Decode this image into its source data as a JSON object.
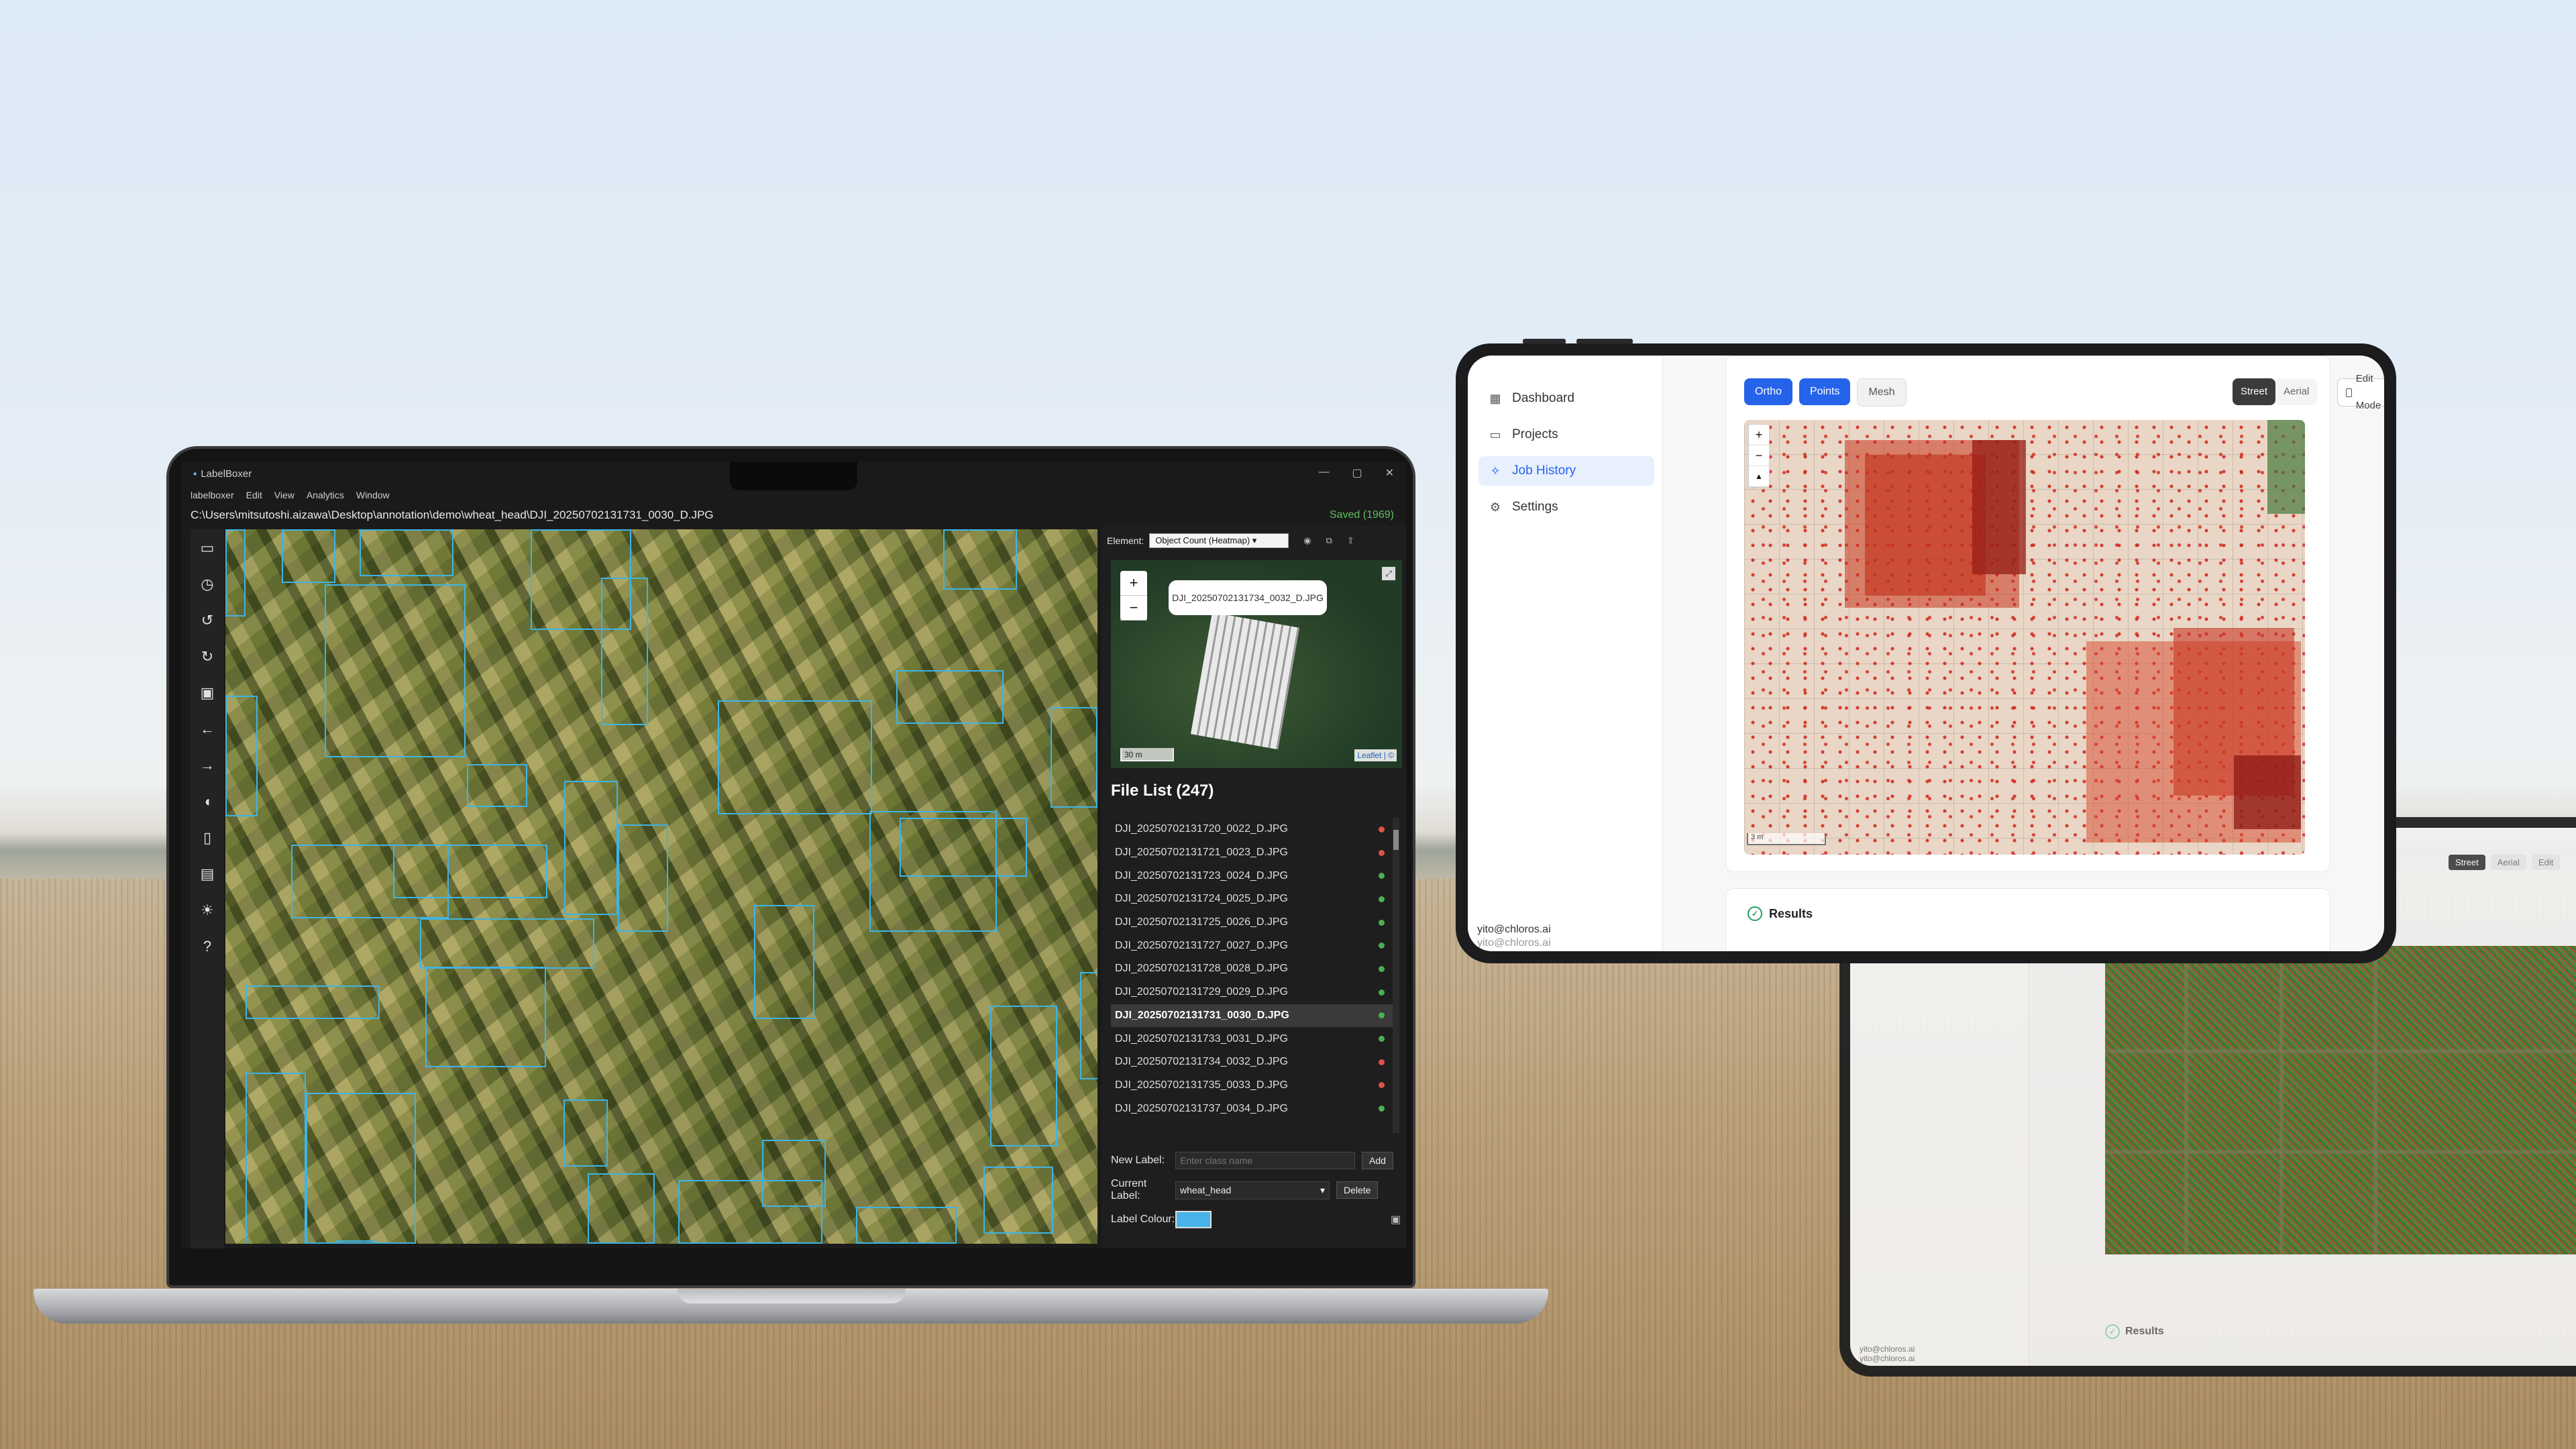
{
  "laptop": {
    "app_title": "LabelBoxer",
    "window_controls": [
      "—",
      "▢",
      "✕"
    ],
    "menu": [
      "labelboxer",
      "Edit",
      "View",
      "Analytics",
      "Window"
    ],
    "path": "C:\\Users\\mitsutoshi.aizawa\\Desktop\\annotation\\demo\\wheat_head\\DJI_20250702131731_0030_D.JPG",
    "saved_status": "Saved (1969)",
    "tools": [
      "folder-icon",
      "history-icon",
      "undo-icon",
      "redo-icon",
      "save-icon",
      "arrow-left-icon",
      "arrow-right-icon",
      "label-icon",
      "map-icon",
      "chart-icon",
      "brightness-icon",
      "help-icon"
    ],
    "element_label": "Element:",
    "element_value": "Object Count (Heatmap)",
    "minimap": {
      "popup": "DJI_20250702131734_0032_D.JPG",
      "scale": "30 m",
      "attribution": "Leaflet | ©",
      "zoom_in": "+",
      "zoom_out": "−"
    },
    "file_list_title": "File List (247)",
    "files": [
      {
        "name": "DJI_20250702131720_0022_D.JPG",
        "status": "#e0514a",
        "selected": false
      },
      {
        "name": "DJI_20250702131721_0023_D.JPG",
        "status": "#e0514a",
        "selected": false
      },
      {
        "name": "DJI_20250702131723_0024_D.JPG",
        "status": "#4caf50",
        "selected": false
      },
      {
        "name": "DJI_20250702131724_0025_D.JPG",
        "status": "#4caf50",
        "selected": false
      },
      {
        "name": "DJI_20250702131725_0026_D.JPG",
        "status": "#4caf50",
        "selected": false
      },
      {
        "name": "DJI_20250702131727_0027_D.JPG",
        "status": "#4caf50",
        "selected": false
      },
      {
        "name": "DJI_20250702131728_0028_D.JPG",
        "status": "#4caf50",
        "selected": false
      },
      {
        "name": "DJI_20250702131729_0029_D.JPG",
        "status": "#4caf50",
        "selected": false
      },
      {
        "name": "DJI_20250702131731_0030_D.JPG",
        "status": "#4caf50",
        "selected": true
      },
      {
        "name": "DJI_20250702131733_0031_D.JPG",
        "status": "#4caf50",
        "selected": false
      },
      {
        "name": "DJI_20250702131734_0032_D.JPG",
        "status": "#e0514a",
        "selected": false
      },
      {
        "name": "DJI_20250702131735_0033_D.JPG",
        "status": "#e0514a",
        "selected": false
      },
      {
        "name": "DJI_20250702131737_0034_D.JPG",
        "status": "#4caf50",
        "selected": false
      }
    ],
    "new_label": "New Label:",
    "new_label_placeholder": "Enter class name",
    "add_button": "Add",
    "current_label": "Current Label:",
    "current_label_value": "wheat_head",
    "delete_button": "Delete",
    "label_colour": "Label Colour:",
    "label_colour_value": "#47b3e8",
    "bbox_color": "#3fb4e4"
  },
  "tablet_front": {
    "nav": [
      {
        "label": "Dashboard",
        "icon": "grid-icon",
        "active": false
      },
      {
        "label": "Projects",
        "icon": "folder-icon",
        "active": false
      },
      {
        "label": "Job History",
        "icon": "sparkle-icon",
        "active": true
      },
      {
        "label": "Settings",
        "icon": "gear-icon",
        "active": false
      }
    ],
    "view_modes": [
      "Ortho",
      "Points",
      "Mesh"
    ],
    "basemaps": [
      "Street",
      "Aerial"
    ],
    "edit_mode": "Edit Mode",
    "map_zoom_in": "+",
    "map_zoom_out": "−",
    "map_scale": "3 m",
    "results_label": "Results",
    "user_email": "yito@chloros.ai",
    "user_email_2": "yito@chloros.ai",
    "accent": "#2563eb"
  },
  "tablet_back": {
    "basemaps": [
      "Street",
      "Aerial"
    ],
    "edit_mode": "Edit",
    "results_label": "Results",
    "user_email": "yito@chloros.ai",
    "user_email_2": "yito@chloros.ai"
  }
}
